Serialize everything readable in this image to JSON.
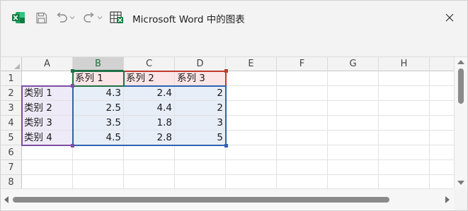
{
  "window": {
    "title": "Microsoft Word 中的图表",
    "icons": [
      "excel-icon",
      "save-icon",
      "undo-icon",
      "redo-icon",
      "chart-data-icon",
      "close-icon"
    ]
  },
  "grid": {
    "columns": [
      "A",
      "B",
      "C",
      "D",
      "E",
      "F",
      "G",
      "H"
    ],
    "rows": [
      "1",
      "2",
      "3",
      "4",
      "5",
      "6",
      "7",
      "8"
    ],
    "selected_column": "B",
    "active_cell": "B1",
    "cells": {
      "B1": "系列 1",
      "C1": "系列 2",
      "D1": "系列 3",
      "A2": "类别 1",
      "B2": "4.3",
      "C2": "2.4",
      "D2": "2",
      "A3": "类别 2",
      "B3": "2.5",
      "C3": "4.4",
      "D3": "2",
      "A4": "类别 3",
      "B4": "3.5",
      "C4": "1.8",
      "D4": "3",
      "A5": "类别 4",
      "B5": "4.5",
      "C5": "2.8",
      "D5": "5"
    }
  },
  "colors": {
    "series_range": "#c0392b",
    "category_range": "#7b4fa3",
    "values_range": "#2f63b0",
    "active_cell": "#1e7145",
    "excel_green": "#107c41"
  }
}
